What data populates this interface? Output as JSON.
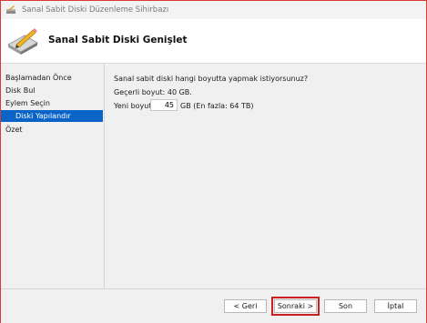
{
  "window": {
    "title": "Sanal Sabit Diski Düzenleme Sihirbazı"
  },
  "header": {
    "title": "Sanal Sabit Diski Genişlet"
  },
  "sidebar": {
    "items": [
      {
        "label": "Başlamadan Önce"
      },
      {
        "label": "Disk Bul"
      },
      {
        "label": "Eylem Seçin"
      },
      {
        "label": "Diski Yapılandır"
      },
      {
        "label": "Özet"
      }
    ],
    "active_index": 3
  },
  "main": {
    "question": "Sanal sabit diski hangi boyutta yapmak istiyorsunuz?",
    "current_size": "Geçerli boyut: 40 GB.",
    "new_size_label": "Yeni boyut:",
    "new_size_value": "45",
    "new_size_suffix": "GB (En fazla: 64 TB)"
  },
  "footer": {
    "back_label": "< Geri",
    "next_label": "Sonraki >",
    "finish_label": "Son",
    "cancel_label": "İptal"
  },
  "colors": {
    "accent": "#0a64c8",
    "highlight_border": "#cc2020"
  },
  "icons": {
    "title": "wizard-disk-icon",
    "header": "hard-disk-pencil-icon"
  }
}
